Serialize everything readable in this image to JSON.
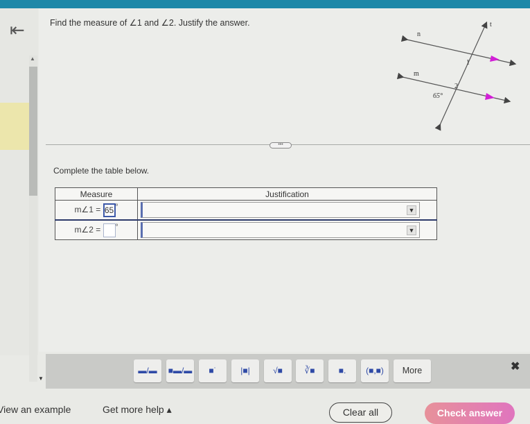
{
  "colors": {
    "topbar": "#1f88a8",
    "accent_arrow": "#d21fd6",
    "check_answer_start": "#e7919a",
    "check_answer_end": "#e075be",
    "active_input_border": "#3c58a8"
  },
  "nav": {
    "back_icon": "first-page-arrow-icon",
    "back_glyph": "⇤",
    "scroll_up_glyph": "▲",
    "scroll_down_glyph": "▼"
  },
  "question": {
    "prefix": "Find the measure of ",
    "angle1": "∠1",
    "middle": " and ",
    "angle2": "∠2",
    "suffix": ". Justify the answer."
  },
  "diagram": {
    "labels": {
      "transversal": "t",
      "line_upper": "n",
      "line_lower": "m",
      "angle1": "1",
      "angle2": "2",
      "given_angle": "65°"
    }
  },
  "divider": {
    "more_label": "•••"
  },
  "instructions": "Complete the table below.",
  "table": {
    "headers": [
      "Measure",
      "Justification"
    ],
    "rows": [
      {
        "label": "m∠1 =",
        "value": "65",
        "unit": "°",
        "justification": "",
        "dropdown_icon": "▼",
        "active": true
      },
      {
        "label": "m∠2 =",
        "value": "",
        "unit": "°",
        "justification": "",
        "dropdown_icon": "▼",
        "active": false
      }
    ]
  },
  "toolbar": {
    "buttons": [
      {
        "name": "fraction",
        "glyph": "▬/▬"
      },
      {
        "name": "mixed-number",
        "glyph": "■▬/▬"
      },
      {
        "name": "exponent",
        "glyph": "■˙"
      },
      {
        "name": "absolute-value",
        "glyph": "|■|"
      },
      {
        "name": "square-root",
        "glyph": "√■"
      },
      {
        "name": "nth-root",
        "glyph": "∛■"
      },
      {
        "name": "subscript",
        "glyph": "■."
      },
      {
        "name": "ordered-pair",
        "glyph": "(■,■)"
      },
      {
        "name": "more",
        "glyph": "More"
      }
    ],
    "close_glyph": "✖"
  },
  "footer": {
    "view_example": "View an example",
    "get_more_help": "Get more help ▴",
    "clear_all": "Clear all",
    "check_answer": "Check answer"
  }
}
